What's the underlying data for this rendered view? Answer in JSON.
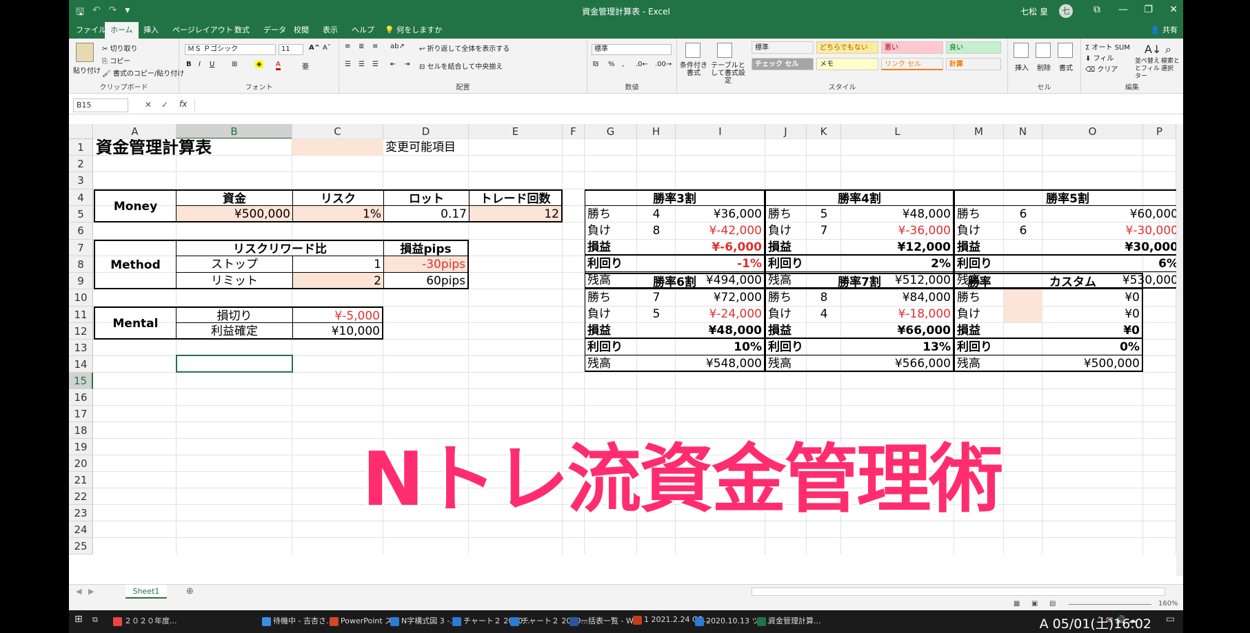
{
  "window": {
    "title": "資金管理計算表 - Excel",
    "user": "七松 皇",
    "avatar_letter": "七",
    "qat": [
      "🖫",
      "↶",
      "↷",
      "▾"
    ],
    "controls": {
      "ribbon_display": "⧉",
      "minimize": "—",
      "restore": "❐",
      "close": "✕"
    }
  },
  "tabs": [
    "ファイル",
    "ホーム",
    "挿入",
    "ページレイアウト",
    "数式",
    "データ",
    "校閲",
    "表示",
    "ヘルプ"
  ],
  "tell_me": "何をしますか",
  "share": "共有",
  "ribbon": {
    "clipboard": {
      "paste": "貼り付け",
      "cut": "切り取り",
      "copy": "コピー",
      "format_painter": "書式のコピー/貼り付け",
      "label": "クリップボード"
    },
    "font": {
      "name": "ＭＳ Ｐゴシック",
      "size": "11",
      "label": "フォント"
    },
    "alignment": {
      "wrap": "折り返して全体を表示する",
      "merge": "セルを結合して中央揃え",
      "label": "配置"
    },
    "number": {
      "format": "標準",
      "label": "数値"
    },
    "styles": {
      "conditional": "条件付き書式",
      "table": "テーブルとして書式設定",
      "cells": [
        {
          "text": "標準",
          "bg": "#ffffff",
          "fg": "#000000"
        },
        {
          "text": "どちらでもない",
          "bg": "#ffeb9c",
          "fg": "#9c5700"
        },
        {
          "text": "悪い",
          "bg": "#ffc7ce",
          "fg": "#9c0006"
        },
        {
          "text": "良い",
          "bg": "#c6efce",
          "fg": "#006100"
        },
        {
          "text": "チェック セル",
          "bg": "#a5a5a5",
          "fg": "#ffffff"
        },
        {
          "text": "メモ",
          "bg": "#ffffcc",
          "fg": "#000000"
        },
        {
          "text": "リンク セル",
          "bg": "#ffffff",
          "fg": "#fa7d00"
        },
        {
          "text": "計算",
          "bg": "#f2f2f2",
          "fg": "#fa7d00"
        }
      ],
      "label": "スタイル"
    },
    "cells_group": {
      "insert": "挿入",
      "delete": "削除",
      "format": "書式",
      "label": "セル"
    },
    "editing": {
      "autosum": "オート SUM",
      "fill": "フィル",
      "clear": "クリア",
      "sort": "並べ替えとフィルター",
      "find": "検索と選択",
      "label": "編集"
    }
  },
  "formula_bar": {
    "name_box": "B15",
    "fx": "fx",
    "cancel": "✕",
    "enter": "✓",
    "formula": ""
  },
  "columns": [
    "A",
    "B",
    "C",
    "D",
    "E",
    "F",
    "G",
    "H",
    "I",
    "J",
    "K",
    "L",
    "M",
    "N",
    "O",
    "P"
  ],
  "rows": [
    "1",
    "2",
    "3",
    "4",
    "5",
    "6",
    "7",
    "8",
    "9",
    "10",
    "11",
    "12",
    "13",
    "14",
    "15",
    "16",
    "17",
    "18",
    "19",
    "20",
    "21",
    "22",
    "23",
    "24",
    "25"
  ],
  "sheet": {
    "title": "資金管理計算表",
    "changeable_label": "変更可能項目",
    "money": {
      "label": "Money",
      "headers": [
        "資金",
        "リスク",
        "ロット",
        "トレード回数"
      ],
      "values": [
        "¥500,000",
        "1%",
        "0.17",
        "12"
      ]
    },
    "method": {
      "label": "Method",
      "rr_header": "リスクリワード比",
      "pips_header": "損益pips",
      "stop_label": "ストップ",
      "stop_value": "1",
      "stop_pips": "-30pips",
      "limit_label": "リミット",
      "limit_value": "2",
      "limit_pips": "60pips"
    },
    "mental": {
      "label": "Mental",
      "loss_cut": "損切り",
      "loss_cut_value": "¥-5,000",
      "take_profit": "利益確定",
      "take_profit_value": "¥10,000"
    },
    "winrate_tables": [
      {
        "title": "勝率3割",
        "win_count": "4",
        "win_amount": "¥36,000",
        "loss_count": "8",
        "loss_amount": "¥-42,000",
        "pnl": "¥-6,000",
        "yield": "-1%",
        "balance": "¥494,000"
      },
      {
        "title": "勝率4割",
        "win_count": "5",
        "win_amount": "¥48,000",
        "loss_count": "7",
        "loss_amount": "¥-36,000",
        "pnl": "¥12,000",
        "yield": "2%",
        "balance": "¥512,000"
      },
      {
        "title": "勝率5割",
        "win_count": "6",
        "win_amount": "¥60,000",
        "loss_count": "6",
        "loss_amount": "¥-30,000",
        "pnl": "¥30,000",
        "yield": "6%",
        "balance": "¥530,000"
      },
      {
        "title": "勝率6割",
        "win_count": "7",
        "win_amount": "¥72,000",
        "loss_count": "5",
        "loss_amount": "¥-24,000",
        "pnl": "¥48,000",
        "yield": "10%",
        "balance": "¥548,000"
      },
      {
        "title": "勝率7割",
        "win_count": "8",
        "win_amount": "¥84,000",
        "loss_count": "4",
        "loss_amount": "¥-18,000",
        "pnl": "¥66,000",
        "yield": "13%",
        "balance": "¥566,000"
      }
    ],
    "custom_table": {
      "winrate_label": "勝率",
      "title": "カスタム",
      "win_amount": "¥0",
      "loss_amount": "¥0",
      "pnl": "¥0",
      "yield": "0%",
      "balance": "¥500,000"
    },
    "labels": {
      "win": "勝ち",
      "loss": "負け",
      "pnl": "損益",
      "yield": "利回り",
      "balance": "残高"
    }
  },
  "sheet_tab": "Sheet1",
  "zoom": "160%",
  "caption": "Nトレ流資金管理術",
  "taskbar": {
    "items": [
      "２０２０年度...",
      "待機中 - 吉杏さ...",
      "PowerPoint ス...",
      "N字構式図 3 -...",
      "チャート２ 2020...",
      "チャート２ 2020...",
      "一括表一覧 - W...",
      "1 2021.2.24 GB...",
      "2020.10.13 ツロ...",
      "資金管理計算..."
    ],
    "clock": "A 05/01(土)16:02"
  }
}
